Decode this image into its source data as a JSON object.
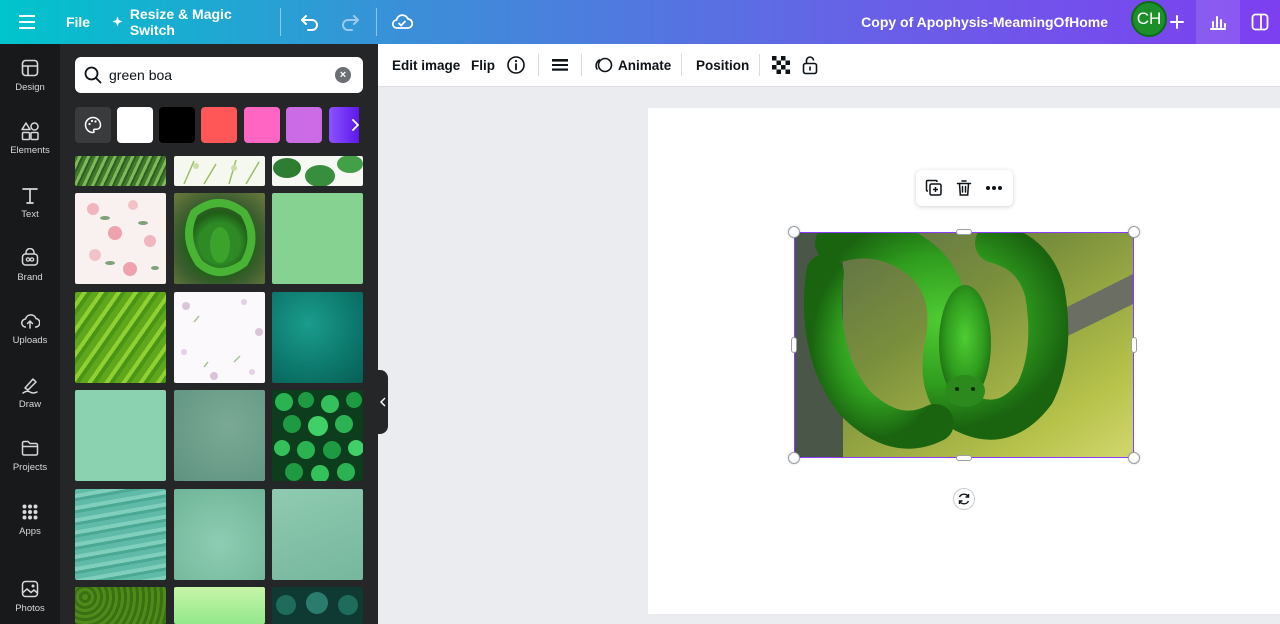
{
  "topbar": {
    "file_label": "File",
    "resize_label": "Resize & Magic Switch",
    "document_title": "Copy of Apophysis-MeamingOfHome",
    "avatar_initials": "CH",
    "gradient_start": "#00c4cc",
    "gradient_end": "#7d3ff0"
  },
  "rail": {
    "items": [
      {
        "label": "Design",
        "icon": "design-icon"
      },
      {
        "label": "Elements",
        "icon": "elements-icon"
      },
      {
        "label": "Text",
        "icon": "text-icon"
      },
      {
        "label": "Brand",
        "icon": "brand-icon"
      },
      {
        "label": "Uploads",
        "icon": "uploads-icon"
      },
      {
        "label": "Draw",
        "icon": "draw-icon"
      },
      {
        "label": "Projects",
        "icon": "projects-icon"
      },
      {
        "label": "Apps",
        "icon": "apps-icon"
      },
      {
        "label": "Photos",
        "icon": "photos-icon"
      }
    ]
  },
  "panel": {
    "search_value": "green boa",
    "swatches": [
      "#ffffff",
      "#000000",
      "#ff5757",
      "#ff66c4",
      "#cb6ce6",
      "#8c52ff"
    ]
  },
  "context_toolbar": {
    "edit_image": "Edit image",
    "flip": "Flip",
    "animate": "Animate",
    "position": "Position"
  },
  "accent": "#8b3dff"
}
